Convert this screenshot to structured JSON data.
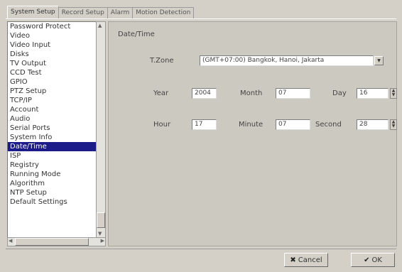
{
  "tabs": [
    {
      "label": "System Setup",
      "active": true
    },
    {
      "label": "Record Setup",
      "active": false
    },
    {
      "label": "Alarm",
      "active": false
    },
    {
      "label": "Motion Detection",
      "active": false
    }
  ],
  "sidebar": {
    "items": [
      "Password Protect",
      "Video",
      "Video Input",
      "Disks",
      "TV Output",
      "CCD Test",
      "GPIO",
      "PTZ Setup",
      "TCP/IP",
      "Account",
      "Audio",
      "Serial Ports",
      "System Info",
      "Date/Time",
      "ISP",
      "Registry",
      "Running Mode",
      "Algorithm",
      "NTP Setup",
      "Default Settings"
    ],
    "selected_index": 13
  },
  "datetime": {
    "group_title": "Date/Time",
    "tzone_label": "T.Zone",
    "tzone_value": "(GMT+07:00) Bangkok, Hanoi, Jakarta",
    "year_label": "Year",
    "year_value": "2004",
    "month_label": "Month",
    "month_value": "07",
    "day_label": "Day",
    "day_value": "16",
    "hour_label": "Hour",
    "hour_value": "17",
    "minute_label": "Minute",
    "minute_value": "07",
    "second_label": "Second",
    "second_value": "28"
  },
  "buttons": {
    "cancel_label": "Cancel",
    "ok_label": "OK"
  },
  "icons": {
    "cancel": "x-icon",
    "ok": "check-icon",
    "dropdown": "chevron-down-icon"
  }
}
